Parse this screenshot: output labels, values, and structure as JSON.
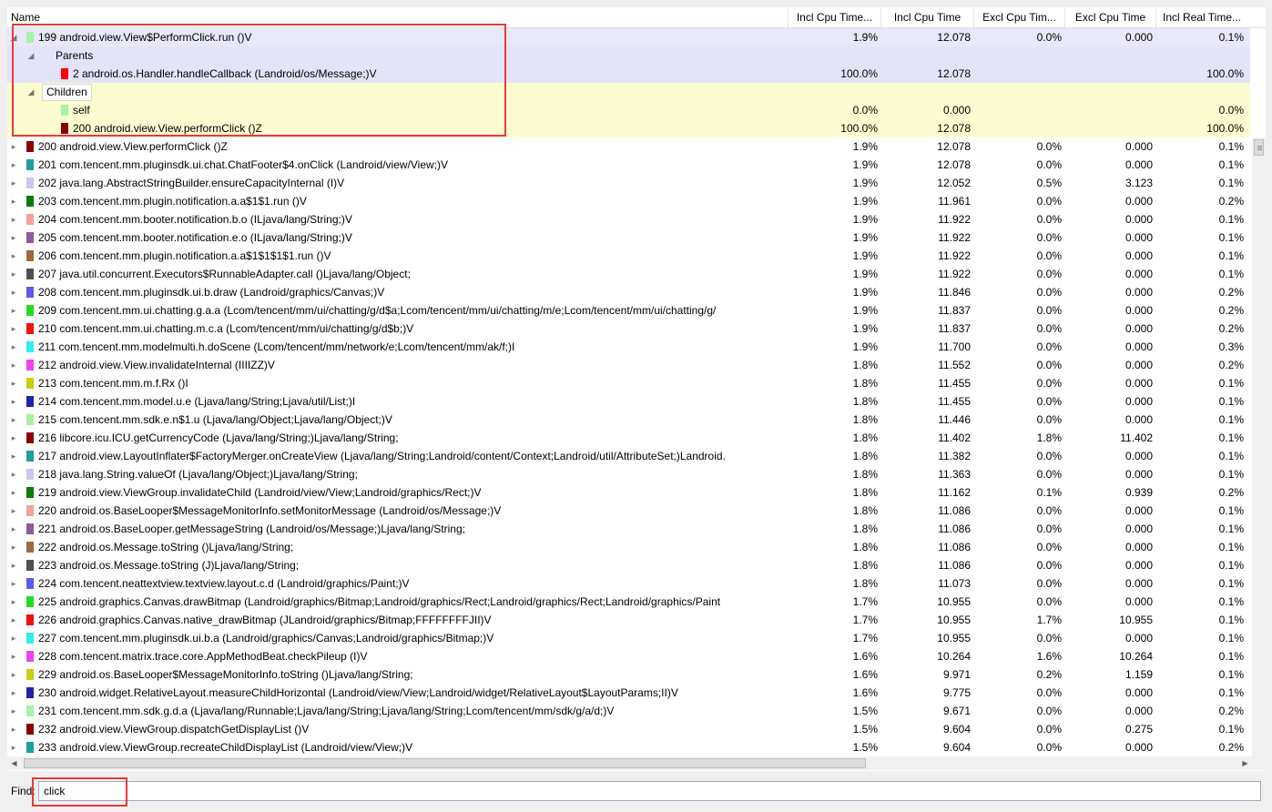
{
  "columns": {
    "name": "Name",
    "incl_cpu_pct": "Incl Cpu Time...",
    "incl_cpu": "Incl Cpu Time",
    "excl_cpu_pct": "Excl Cpu Tim...",
    "excl_cpu": "Excl Cpu Time",
    "incl_real_pct": "Incl Real Time..."
  },
  "selected": {
    "name": "199 android.view.View$PerformClick.run ()V",
    "color": "#a6f2a6",
    "incl_pct": "1.9%",
    "incl": "12.078",
    "excl_pct": "0.0%",
    "excl": "0.000",
    "real_pct": "0.1%",
    "parents_label": "Parents",
    "parents": [
      {
        "name": "2 android.os.Handler.handleCallback (Landroid/os/Message;)V",
        "color": "#ff0000",
        "incl_pct": "100.0%",
        "incl": "12.078",
        "real_pct": "100.0%"
      }
    ],
    "children_label": "Children",
    "children": [
      {
        "name": "self",
        "color": "#a6f2a6",
        "incl_pct": "0.0%",
        "incl": "0.000",
        "real_pct": "0.0%"
      },
      {
        "name": "200 android.view.View.performClick ()Z",
        "color": "#8b0000",
        "incl_pct": "100.0%",
        "incl": "12.078",
        "real_pct": "100.0%"
      }
    ]
  },
  "rows": [
    {
      "name": "200 android.view.View.performClick ()Z",
      "color": "#8b0000",
      "incl_pct": "1.9%",
      "incl": "12.078",
      "excl_pct": "0.0%",
      "excl": "0.000",
      "real_pct": "0.1%"
    },
    {
      "name": "201 com.tencent.mm.pluginsdk.ui.chat.ChatFooter$4.onClick (Landroid/view/View;)V",
      "color": "#1f9e9e",
      "incl_pct": "1.9%",
      "incl": "12.078",
      "excl_pct": "0.0%",
      "excl": "0.000",
      "real_pct": "0.1%"
    },
    {
      "name": "202 java.lang.AbstractStringBuilder.ensureCapacityInternal (I)V",
      "color": "#c8c8f0",
      "incl_pct": "1.9%",
      "incl": "12.052",
      "excl_pct": "0.5%",
      "excl": "3.123",
      "real_pct": "0.1%"
    },
    {
      "name": "203 com.tencent.mm.plugin.notification.a.a$1$1.run ()V",
      "color": "#0d7a0d",
      "incl_pct": "1.9%",
      "incl": "11.961",
      "excl_pct": "0.0%",
      "excl": "0.000",
      "real_pct": "0.2%"
    },
    {
      "name": "204 com.tencent.mm.booter.notification.b.o (ILjava/lang/String;)V",
      "color": "#f4a0a0",
      "incl_pct": "1.9%",
      "incl": "11.922",
      "excl_pct": "0.0%",
      "excl": "0.000",
      "real_pct": "0.1%"
    },
    {
      "name": "205 com.tencent.mm.booter.notification.e.o (ILjava/lang/String;)V",
      "color": "#8e5a9e",
      "incl_pct": "1.9%",
      "incl": "11.922",
      "excl_pct": "0.0%",
      "excl": "0.000",
      "real_pct": "0.1%"
    },
    {
      "name": "206 com.tencent.mm.plugin.notification.a.a$1$1$1$1.run ()V",
      "color": "#9e6a3a",
      "incl_pct": "1.9%",
      "incl": "11.922",
      "excl_pct": "0.0%",
      "excl": "0.000",
      "real_pct": "0.1%"
    },
    {
      "name": "207 java.util.concurrent.Executors$RunnableAdapter.call ()Ljava/lang/Object;",
      "color": "#505050",
      "incl_pct": "1.9%",
      "incl": "11.922",
      "excl_pct": "0.0%",
      "excl": "0.000",
      "real_pct": "0.1%"
    },
    {
      "name": "208 com.tencent.mm.pluginsdk.ui.b.draw (Landroid/graphics/Canvas;)V",
      "color": "#5a5aee",
      "incl_pct": "1.9%",
      "incl": "11.846",
      "excl_pct": "0.0%",
      "excl": "0.000",
      "real_pct": "0.2%"
    },
    {
      "name": "209 com.tencent.mm.ui.chatting.g.a.a (Lcom/tencent/mm/ui/chatting/g/d$a;Lcom/tencent/mm/ui/chatting/m/e;Lcom/tencent/mm/ui/chatting/g/",
      "color": "#22dd22",
      "incl_pct": "1.9%",
      "incl": "11.837",
      "excl_pct": "0.0%",
      "excl": "0.000",
      "real_pct": "0.2%"
    },
    {
      "name": "210 com.tencent.mm.ui.chatting.m.c.a (Lcom/tencent/mm/ui/chatting/g/d$b;)V",
      "color": "#ee1111",
      "incl_pct": "1.9%",
      "incl": "11.837",
      "excl_pct": "0.0%",
      "excl": "0.000",
      "real_pct": "0.2%"
    },
    {
      "name": "211 com.tencent.mm.modelmulti.h.doScene (Lcom/tencent/mm/network/e;Lcom/tencent/mm/ak/f;)I",
      "color": "#33eeee",
      "incl_pct": "1.9%",
      "incl": "11.700",
      "excl_pct": "0.0%",
      "excl": "0.000",
      "real_pct": "0.3%"
    },
    {
      "name": "212 android.view.View.invalidateInternal (IIIIZZ)V",
      "color": "#ee44ee",
      "incl_pct": "1.8%",
      "incl": "11.552",
      "excl_pct": "0.0%",
      "excl": "0.000",
      "real_pct": "0.2%"
    },
    {
      "name": "213 com.tencent.mm.m.f.Rx ()I",
      "color": "#cccc11",
      "incl_pct": "1.8%",
      "incl": "11.455",
      "excl_pct": "0.0%",
      "excl": "0.000",
      "real_pct": "0.1%"
    },
    {
      "name": "214 com.tencent.mm.model.u.e (Ljava/lang/String;Ljava/util/List;)I",
      "color": "#2222aa",
      "incl_pct": "1.8%",
      "incl": "11.455",
      "excl_pct": "0.0%",
      "excl": "0.000",
      "real_pct": "0.1%"
    },
    {
      "name": "215 com.tencent.mm.sdk.e.n$1.u (Ljava/lang/Object;Ljava/lang/Object;)V",
      "color": "#a6f2a6",
      "incl_pct": "1.8%",
      "incl": "11.446",
      "excl_pct": "0.0%",
      "excl": "0.000",
      "real_pct": "0.1%"
    },
    {
      "name": "216 libcore.icu.ICU.getCurrencyCode (Ljava/lang/String;)Ljava/lang/String;",
      "color": "#8b0000",
      "incl_pct": "1.8%",
      "incl": "11.402",
      "excl_pct": "1.8%",
      "excl": "11.402",
      "real_pct": "0.1%"
    },
    {
      "name": "217 android.view.LayoutInflater$FactoryMerger.onCreateView (Ljava/lang/String;Landroid/content/Context;Landroid/util/AttributeSet;)Landroid.",
      "color": "#1f9e9e",
      "incl_pct": "1.8%",
      "incl": "11.382",
      "excl_pct": "0.0%",
      "excl": "0.000",
      "real_pct": "0.1%"
    },
    {
      "name": "218 java.lang.String.valueOf (Ljava/lang/Object;)Ljava/lang/String;",
      "color": "#c8c8f0",
      "incl_pct": "1.8%",
      "incl": "11.363",
      "excl_pct": "0.0%",
      "excl": "0.000",
      "real_pct": "0.1%"
    },
    {
      "name": "219 android.view.ViewGroup.invalidateChild (Landroid/view/View;Landroid/graphics/Rect;)V",
      "color": "#0d7a0d",
      "incl_pct": "1.8%",
      "incl": "11.162",
      "excl_pct": "0.1%",
      "excl": "0.939",
      "real_pct": "0.2%"
    },
    {
      "name": "220 android.os.BaseLooper$MessageMonitorInfo.setMonitorMessage (Landroid/os/Message;)V",
      "color": "#f4a0a0",
      "incl_pct": "1.8%",
      "incl": "11.086",
      "excl_pct": "0.0%",
      "excl": "0.000",
      "real_pct": "0.1%"
    },
    {
      "name": "221 android.os.BaseLooper.getMessageString (Landroid/os/Message;)Ljava/lang/String;",
      "color": "#8e5a9e",
      "incl_pct": "1.8%",
      "incl": "11.086",
      "excl_pct": "0.0%",
      "excl": "0.000",
      "real_pct": "0.1%"
    },
    {
      "name": "222 android.os.Message.toString ()Ljava/lang/String;",
      "color": "#9e6a3a",
      "incl_pct": "1.8%",
      "incl": "11.086",
      "excl_pct": "0.0%",
      "excl": "0.000",
      "real_pct": "0.1%"
    },
    {
      "name": "223 android.os.Message.toString (J)Ljava/lang/String;",
      "color": "#505050",
      "incl_pct": "1.8%",
      "incl": "11.086",
      "excl_pct": "0.0%",
      "excl": "0.000",
      "real_pct": "0.1%"
    },
    {
      "name": "224 com.tencent.neattextview.textview.layout.c.d (Landroid/graphics/Paint;)V",
      "color": "#5a5aee",
      "incl_pct": "1.8%",
      "incl": "11.073",
      "excl_pct": "0.0%",
      "excl": "0.000",
      "real_pct": "0.1%"
    },
    {
      "name": "225 android.graphics.Canvas.drawBitmap (Landroid/graphics/Bitmap;Landroid/graphics/Rect;Landroid/graphics/Rect;Landroid/graphics/Paint",
      "color": "#22dd22",
      "incl_pct": "1.7%",
      "incl": "10.955",
      "excl_pct": "0.0%",
      "excl": "0.000",
      "real_pct": "0.1%"
    },
    {
      "name": "226 android.graphics.Canvas.native_drawBitmap (JLandroid/graphics/Bitmap;FFFFFFFFJII)V",
      "color": "#ee1111",
      "incl_pct": "1.7%",
      "incl": "10.955",
      "excl_pct": "1.7%",
      "excl": "10.955",
      "real_pct": "0.1%"
    },
    {
      "name": "227 com.tencent.mm.pluginsdk.ui.b.a (Landroid/graphics/Canvas;Landroid/graphics/Bitmap;)V",
      "color": "#33eeee",
      "incl_pct": "1.7%",
      "incl": "10.955",
      "excl_pct": "0.0%",
      "excl": "0.000",
      "real_pct": "0.1%"
    },
    {
      "name": "228 com.tencent.matrix.trace.core.AppMethodBeat.checkPileup (I)V",
      "color": "#ee44ee",
      "incl_pct": "1.6%",
      "incl": "10.264",
      "excl_pct": "1.6%",
      "excl": "10.264",
      "real_pct": "0.1%"
    },
    {
      "name": "229 android.os.BaseLooper$MessageMonitorInfo.toString ()Ljava/lang/String;",
      "color": "#cccc11",
      "incl_pct": "1.6%",
      "incl": "9.971",
      "excl_pct": "0.2%",
      "excl": "1.159",
      "real_pct": "0.1%"
    },
    {
      "name": "230 android.widget.RelativeLayout.measureChildHorizontal (Landroid/view/View;Landroid/widget/RelativeLayout$LayoutParams;II)V",
      "color": "#2222aa",
      "incl_pct": "1.6%",
      "incl": "9.775",
      "excl_pct": "0.0%",
      "excl": "0.000",
      "real_pct": "0.1%"
    },
    {
      "name": "231 com.tencent.mm.sdk.g.d.a (Ljava/lang/Runnable;Ljava/lang/String;Ljava/lang/String;Lcom/tencent/mm/sdk/g/a/d;)V",
      "color": "#a6f2a6",
      "incl_pct": "1.5%",
      "incl": "9.671",
      "excl_pct": "0.0%",
      "excl": "0.000",
      "real_pct": "0.2%"
    },
    {
      "name": "232 android.view.ViewGroup.dispatchGetDisplayList ()V",
      "color": "#8b0000",
      "incl_pct": "1.5%",
      "incl": "9.604",
      "excl_pct": "0.0%",
      "excl": "0.275",
      "real_pct": "0.1%"
    },
    {
      "name": "233 android.view.ViewGroup.recreateChildDisplayList (Landroid/view/View;)V",
      "color": "#1f9e9e",
      "incl_pct": "1.5%",
      "incl": "9.604",
      "excl_pct": "0.0%",
      "excl": "0.000",
      "real_pct": "0.2%"
    }
  ],
  "find": {
    "label": "Find:",
    "value": "click"
  },
  "icons": {
    "expand": "triangle-right-icon",
    "collapse": "triangle-down-icon"
  },
  "highlight_color": "#e8393f"
}
